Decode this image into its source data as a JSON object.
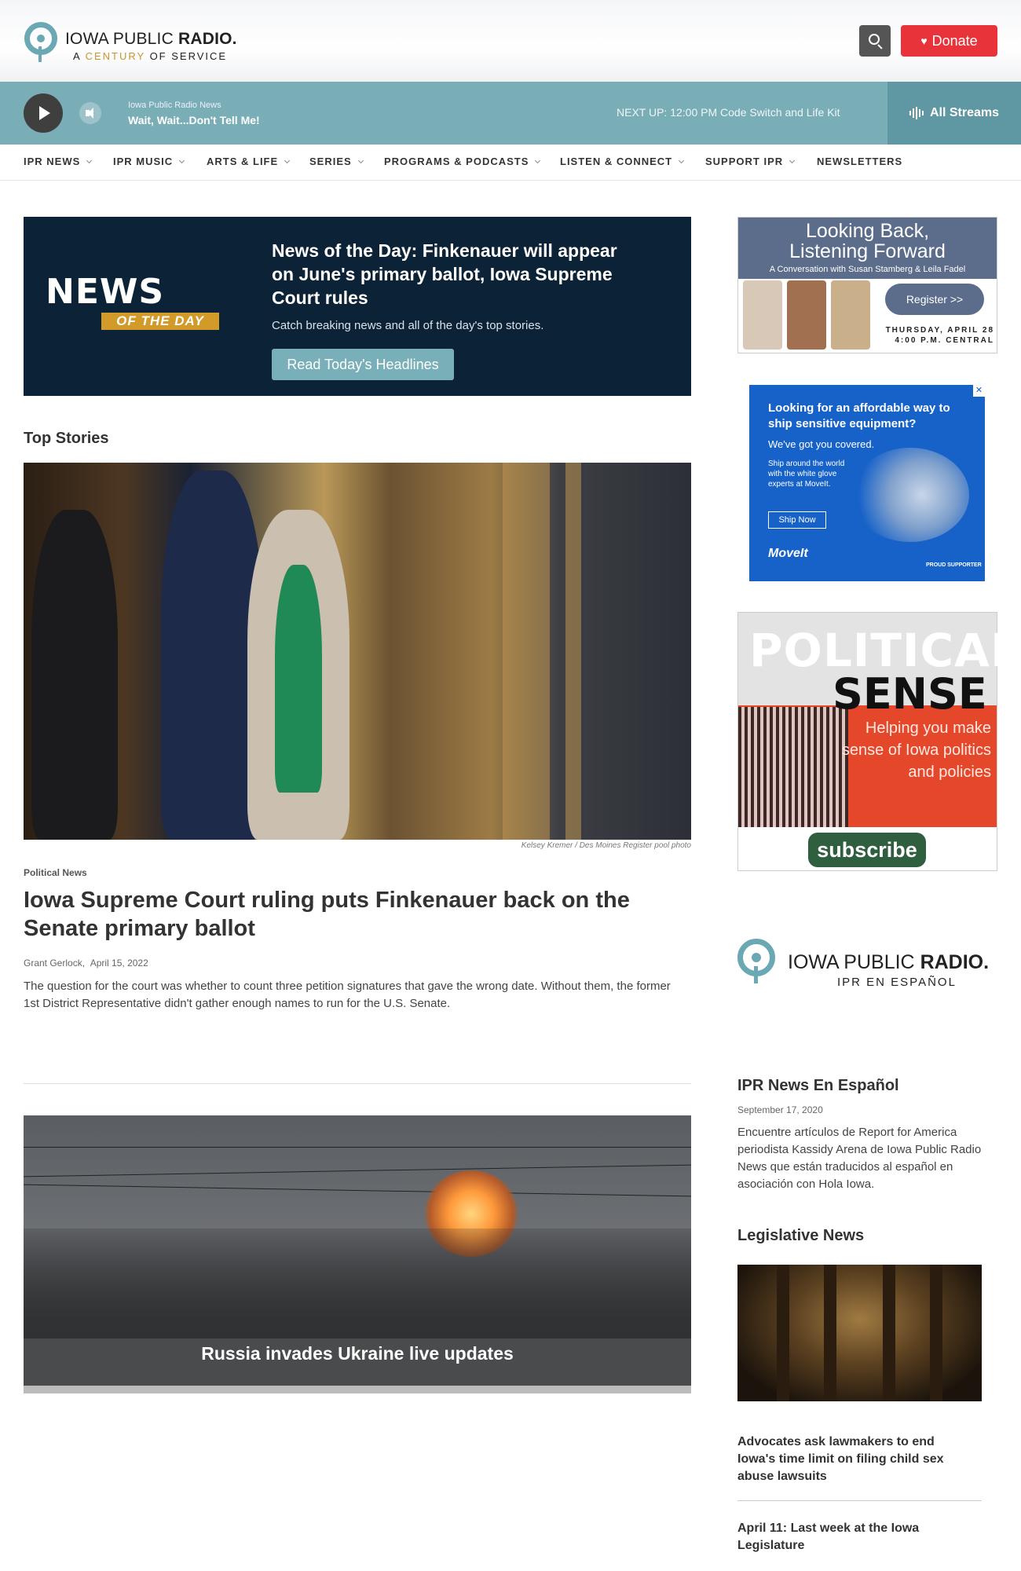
{
  "header": {
    "logo_title_light": "IOWA PUBLIC ",
    "logo_title_bold": "RADIO.",
    "logo_sub_a": "A ",
    "logo_sub_century": "CENTURY",
    "logo_sub_b": " OF SERVICE",
    "search_icon": "search-icon",
    "donate_label": "Donate",
    "donate_icon": "heart-icon"
  },
  "player": {
    "station": "Iowa Public Radio News",
    "show": "Wait, Wait...Don't Tell Me!",
    "next_up": "NEXT UP:  12:00 PM  Code Switch and Life Kit",
    "all_streams": "All Streams"
  },
  "nav": {
    "items": [
      {
        "label": "IPR NEWS",
        "has_dropdown": true
      },
      {
        "label": "IPR MUSIC",
        "has_dropdown": true
      },
      {
        "label": "ARTS & LIFE",
        "has_dropdown": true
      },
      {
        "label": "SERIES",
        "has_dropdown": true
      },
      {
        "label": "PROGRAMS & PODCASTS",
        "has_dropdown": true
      },
      {
        "label": "LISTEN & CONNECT",
        "has_dropdown": true
      },
      {
        "label": "SUPPORT IPR",
        "has_dropdown": true
      },
      {
        "label": "NEWSLETTERS",
        "has_dropdown": false
      }
    ]
  },
  "notd": {
    "logo_news": "NEWS",
    "logo_otd": "OF THE DAY",
    "title": "News of the Day: Finkenauer will appear on June's primary ballot, Iowa Supreme Court rules",
    "description": "Catch breaking news and all of the day's top stories.",
    "button": "Read Today's Headlines"
  },
  "top_stories": {
    "heading": "Top Stories",
    "lead": {
      "credit": "Kelsey Kremer  /  Des Moines Register pool photo",
      "kicker": "Political News",
      "title": "Iowa Supreme Court ruling puts Finkenauer back on the Senate primary ballot",
      "author": "Grant Gerlock",
      "date": "April 15, 2022",
      "teaser": "The question for the court was whether to count three petition signatures that gave the wrong date. Without them, the former 1st District Representative didn't gather enough names to run for the U.S. Senate."
    },
    "second": {
      "title": "Russia invades Ukraine live updates"
    }
  },
  "sidebar": {
    "ad1": {
      "title_line1": "Looking Back,",
      "title_line2": "Listening Forward",
      "subtitle": "A Conversation with Susan Stamberg & Leila Fadel",
      "register": "Register >>",
      "date_line1": "THURSDAY, APRIL 28",
      "date_line2": "4:00 P.M. CENTRAL"
    },
    "ad2": {
      "close": "✕",
      "headline": "Looking for an affordable way to ship sensitive equipment?",
      "sub": "We've got you covered.",
      "body": "Ship around the world with the white glove experts at MoveIt.",
      "button": "Ship Now",
      "brand": "MoveIt",
      "badge": "PROUD SUPPORTER"
    },
    "ad3": {
      "political": "POLITICAL",
      "sense": "SENSE",
      "tagline": "Helping you make sense of Iowa politics and policies",
      "button": "subscribe"
    },
    "ipr_es": {
      "name_light": "IOWA PUBLIC ",
      "name_bold": "RADIO.",
      "esp": "IPR EN ESPAÑOL"
    },
    "es_story": {
      "title": "IPR News En Español",
      "date": "September 17, 2020",
      "text": "Encuentre artículos de Report for America periodista Kassidy Arena de Iowa Public Radio News que están traducidos al español en asociación con Hola Iowa."
    },
    "legislative": {
      "heading": "Legislative News",
      "stories": [
        "Advocates ask lawmakers to end Iowa's time limit on filing child sex abuse lawsuits",
        "April 11: Last week at the Iowa Legislature"
      ]
    }
  },
  "colors": {
    "teal": "#7aaeb7",
    "donate_red": "#e8333a",
    "navy": "#0c2236",
    "gold": "#d19a29"
  }
}
